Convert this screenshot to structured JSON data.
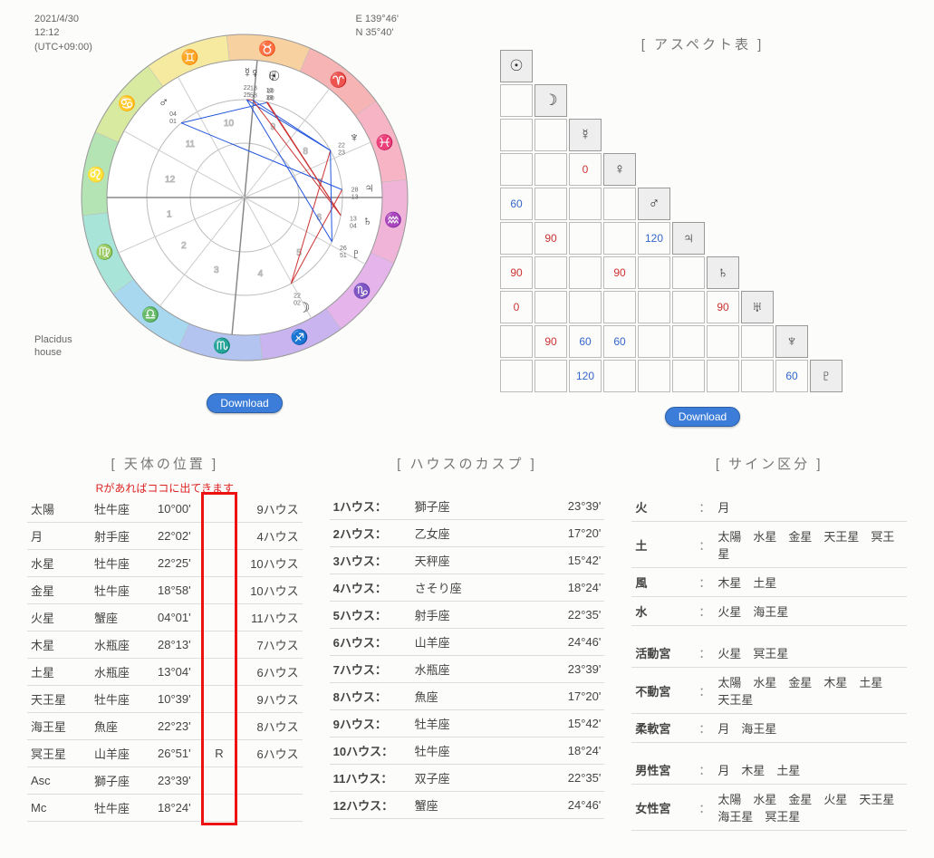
{
  "meta": {
    "date": "2021/4/30",
    "time": "12:12",
    "tz": "(UTC+09:00)",
    "lon": "E 139°46'",
    "lat": "N 35°40'",
    "house_system": "Placidus\nhouse"
  },
  "download_label": "Download",
  "aspect_title": "[ アスペクト表 ]",
  "glyphs": {
    "sun": "☉",
    "moon": "☽",
    "mercury": "☿",
    "venus": "♀",
    "mars": "♂",
    "jupiter": "♃",
    "saturn": "♄",
    "uranus": "♅",
    "neptune": "♆",
    "pluto": "♇"
  },
  "aspect_rows": [
    {
      "hd": "sun",
      "cells": []
    },
    {
      "hd": "moon",
      "cells": [
        ""
      ]
    },
    {
      "hd": "mercury",
      "cells": [
        "",
        ""
      ]
    },
    {
      "hd": "venus",
      "cells": [
        "",
        "",
        "0r"
      ]
    },
    {
      "hd": "mars",
      "cells": [
        "60b",
        "",
        "",
        ""
      ]
    },
    {
      "hd": "jupiter",
      "cells": [
        "",
        "90r",
        "",
        "",
        "120b"
      ]
    },
    {
      "hd": "saturn",
      "cells": [
        "90r",
        "",
        "",
        "90r",
        "",
        ""
      ]
    },
    {
      "hd": "uranus",
      "cells": [
        "0r",
        "",
        "",
        "",
        "",
        "",
        "90r"
      ]
    },
    {
      "hd": "neptune",
      "cells": [
        "",
        "90r",
        "60b",
        "60b",
        "",
        "",
        "",
        ""
      ]
    },
    {
      "hd": "pluto",
      "cells": [
        "",
        "",
        "120b",
        "",
        "",
        "",
        "",
        "",
        "60b"
      ]
    }
  ],
  "pos_title": "[ 天体の位置 ]",
  "pos_note": "Rがあればココに出てきます",
  "positions": [
    {
      "p": "太陽",
      "s": "牡牛座",
      "d": "10°00'",
      "r": "",
      "h": "9ハウス"
    },
    {
      "p": "月",
      "s": "射手座",
      "d": "22°02'",
      "r": "",
      "h": "4ハウス"
    },
    {
      "p": "水星",
      "s": "牡牛座",
      "d": "22°25'",
      "r": "",
      "h": "10ハウス"
    },
    {
      "p": "金星",
      "s": "牡牛座",
      "d": "18°58'",
      "r": "",
      "h": "10ハウス"
    },
    {
      "p": "火星",
      "s": "蟹座",
      "d": "04°01'",
      "r": "",
      "h": "11ハウス"
    },
    {
      "p": "木星",
      "s": "水瓶座",
      "d": "28°13'",
      "r": "",
      "h": "7ハウス"
    },
    {
      "p": "土星",
      "s": "水瓶座",
      "d": "13°04'",
      "r": "",
      "h": "6ハウス"
    },
    {
      "p": "天王星",
      "s": "牡牛座",
      "d": "10°39'",
      "r": "",
      "h": "9ハウス"
    },
    {
      "p": "海王星",
      "s": "魚座",
      "d": "22°23'",
      "r": "",
      "h": "8ハウス"
    },
    {
      "p": "冥王星",
      "s": "山羊座",
      "d": "26°51'",
      "r": "R",
      "h": "6ハウス"
    },
    {
      "p": "Asc",
      "s": "獅子座",
      "d": "23°39'",
      "r": "",
      "h": ""
    },
    {
      "p": "Mc",
      "s": "牡牛座",
      "d": "18°24'",
      "r": "",
      "h": ""
    }
  ],
  "cusp_title": "[ ハウスのカスプ ]",
  "cusps": [
    {
      "h": "1ハウス：",
      "s": "獅子座",
      "d": "23°39'"
    },
    {
      "h": "2ハウス：",
      "s": "乙女座",
      "d": "17°20'"
    },
    {
      "h": "3ハウス：",
      "s": "天秤座",
      "d": "15°42'"
    },
    {
      "h": "4ハウス：",
      "s": "さそり座",
      "d": "18°24'"
    },
    {
      "h": "5ハウス：",
      "s": "射手座",
      "d": "22°35'"
    },
    {
      "h": "6ハウス：",
      "s": "山羊座",
      "d": "24°46'"
    },
    {
      "h": "7ハウス：",
      "s": "水瓶座",
      "d": "23°39'"
    },
    {
      "h": "8ハウス：",
      "s": "魚座",
      "d": "17°20'"
    },
    {
      "h": "9ハウス：",
      "s": "牡羊座",
      "d": "15°42'"
    },
    {
      "h": "10ハウス：",
      "s": "牡牛座",
      "d": "18°24'"
    },
    {
      "h": "11ハウス：",
      "s": "双子座",
      "d": "22°35'"
    },
    {
      "h": "12ハウス：",
      "s": "蟹座",
      "d": "24°46'"
    }
  ],
  "sign_title": "[ サイン区分 ]",
  "sign_rows1": [
    {
      "k": "火",
      "v": "月"
    },
    {
      "k": "土",
      "v": "太陽　水星　金星　天王星　冥王星"
    },
    {
      "k": "風",
      "v": "木星　土星"
    },
    {
      "k": "水",
      "v": "火星　海王星"
    }
  ],
  "sign_rows2": [
    {
      "k": "活動宮",
      "v": "火星　冥王星"
    },
    {
      "k": "不動宮",
      "v": "太陽　水星　金星　木星　土星　天王星"
    },
    {
      "k": "柔軟宮",
      "v": "月　海王星"
    }
  ],
  "sign_rows3": [
    {
      "k": "男性宮",
      "v": "月　木星　土星"
    },
    {
      "k": "女性宮",
      "v": "太陽　水星　金星　火星　天王星　海王星　冥王星"
    }
  ],
  "chart_data": {
    "type": "astrological-chart",
    "house_system": "Placidus",
    "asc_sign": "Leo",
    "asc_deg": 23.65,
    "mc_sign": "Taurus",
    "mc_deg": 18.4,
    "planets": [
      {
        "name": "Sun",
        "sign": "Taurus",
        "deg": 10.0,
        "house": 9,
        "label": "10 00"
      },
      {
        "name": "Moon",
        "sign": "Sagittarius",
        "deg": 22.03,
        "house": 4,
        "label": "22 02"
      },
      {
        "name": "Mercury",
        "sign": "Taurus",
        "deg": 22.42,
        "house": 10,
        "label": "22 25"
      },
      {
        "name": "Venus",
        "sign": "Taurus",
        "deg": 18.97,
        "house": 10,
        "label": "18 58"
      },
      {
        "name": "Mars",
        "sign": "Cancer",
        "deg": 4.02,
        "house": 11,
        "label": "04 01"
      },
      {
        "name": "Jupiter",
        "sign": "Aquarius",
        "deg": 28.22,
        "house": 7,
        "label": "28 13"
      },
      {
        "name": "Saturn",
        "sign": "Aquarius",
        "deg": 13.07,
        "house": 6,
        "label": "13 04"
      },
      {
        "name": "Uranus",
        "sign": "Taurus",
        "deg": 10.65,
        "house": 9,
        "label": "10 39"
      },
      {
        "name": "Neptune",
        "sign": "Pisces",
        "deg": 22.38,
        "house": 8,
        "label": "22 23"
      },
      {
        "name": "Pluto",
        "sign": "Capricorn",
        "deg": 26.85,
        "house": 6,
        "retro": true,
        "label": "26 51"
      }
    ],
    "aspects": [
      {
        "a": "Sun",
        "b": "Mars",
        "deg": 60
      },
      {
        "a": "Sun",
        "b": "Saturn",
        "deg": 90
      },
      {
        "a": "Sun",
        "b": "Uranus",
        "deg": 0
      },
      {
        "a": "Moon",
        "b": "Jupiter",
        "deg": 90
      },
      {
        "a": "Moon",
        "b": "Neptune",
        "deg": 90
      },
      {
        "a": "Mercury",
        "b": "Venus",
        "deg": 0
      },
      {
        "a": "Mercury",
        "b": "Neptune",
        "deg": 60
      },
      {
        "a": "Mercury",
        "b": "Pluto",
        "deg": 120
      },
      {
        "a": "Venus",
        "b": "Saturn",
        "deg": 90
      },
      {
        "a": "Venus",
        "b": "Neptune",
        "deg": 60
      },
      {
        "a": "Mars",
        "b": "Jupiter",
        "deg": 120
      },
      {
        "a": "Saturn",
        "b": "Uranus",
        "deg": 90
      },
      {
        "a": "Neptune",
        "b": "Pluto",
        "deg": 60
      }
    ]
  }
}
